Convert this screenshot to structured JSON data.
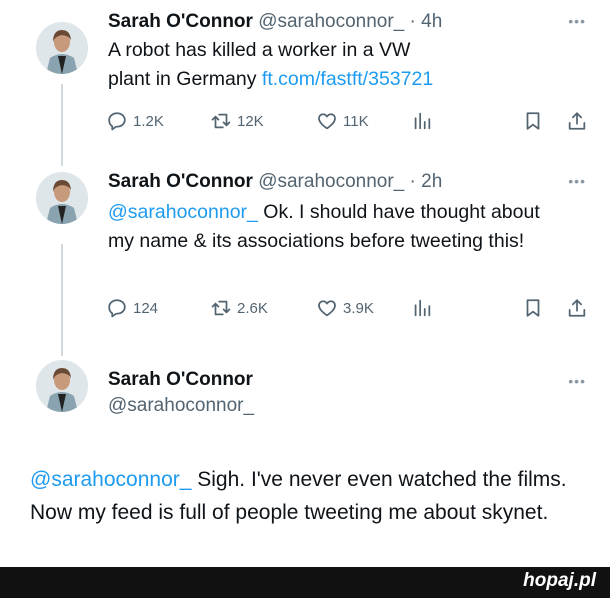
{
  "author": {
    "name": "Sarah O'Connor",
    "handle": "@sarahoconnor_"
  },
  "tweets": [
    {
      "time": "· 4h",
      "text_before": "A robot has killed a worker in a VW plant in Germany ",
      "link": "ft.com/fastft/353721",
      "stats": {
        "replies": "1.2K",
        "retweets": "12K",
        "likes": "11K"
      }
    },
    {
      "time": "· 2h",
      "mention": "@sarahoconnor_",
      "text": " Ok. I should have thought about my name & its associations before tweeting this!",
      "stats": {
        "replies": "124",
        "retweets": "2.6K",
        "likes": "3.9K"
      }
    },
    {
      "mention": "@sarahoconnor_",
      "text": " Sigh. I've never even watched the films. Now my feed is full of people tweeting me about skynet."
    }
  ],
  "more_label": "•••",
  "footer": {
    "brand": "hopaj.pl"
  },
  "colors": {
    "link": "#1d9bf0",
    "muted": "#536471",
    "footer_bg": "#111111"
  },
  "icons": [
    "reply-icon",
    "retweet-icon",
    "like-icon",
    "views-icon",
    "bookmark-icon",
    "share-icon"
  ]
}
